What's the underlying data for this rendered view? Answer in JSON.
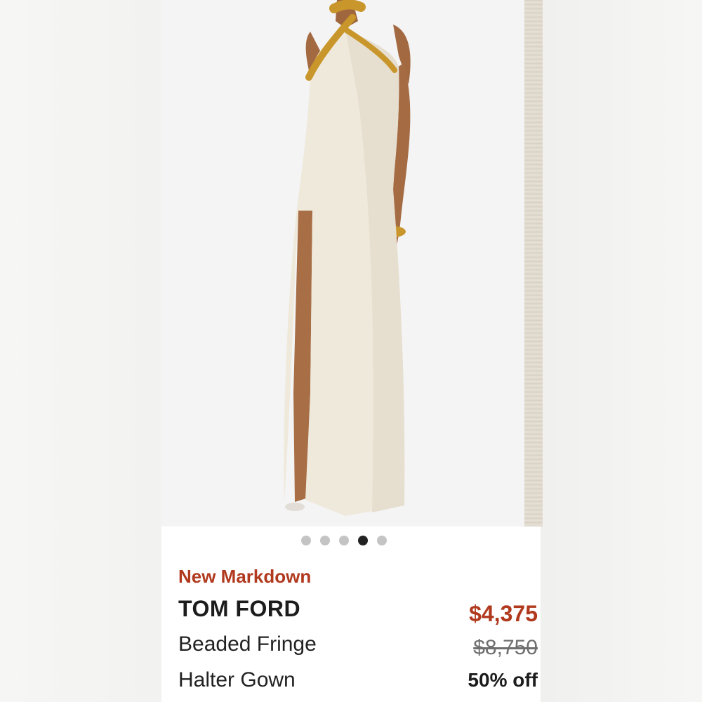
{
  "carousel": {
    "slide_count": 5,
    "active_index": 3
  },
  "listing": {
    "badge": "New Markdown",
    "brand": "TOM FORD",
    "title_line1": "Beaded Fringe",
    "title_line2": "Halter Gown",
    "price": "$4,375",
    "original_price": "$8,750",
    "discount": "50% off"
  },
  "colors": {
    "accent": "#b0391e",
    "text": "#1c1c1c",
    "dot_inactive": "#c4c4c4",
    "dot_active": "#222222"
  }
}
